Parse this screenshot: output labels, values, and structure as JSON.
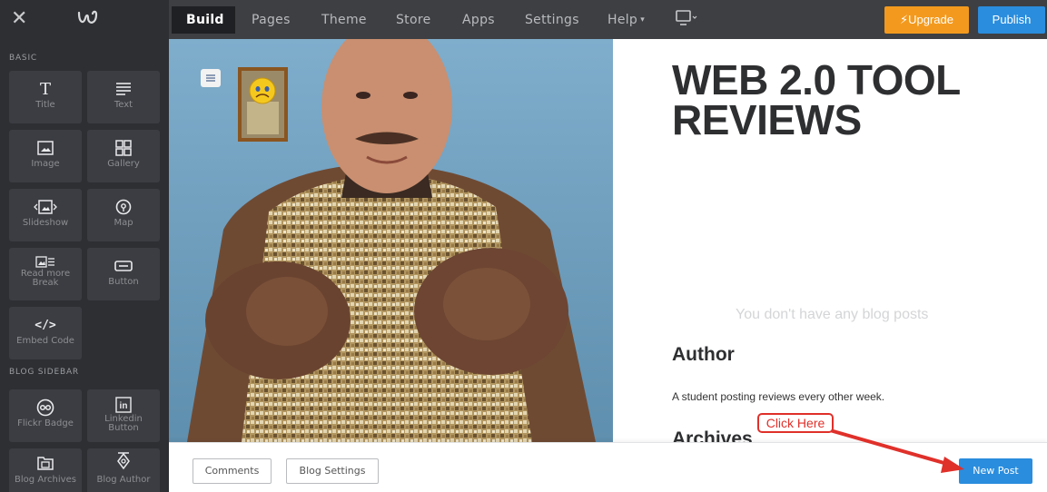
{
  "topbar": {
    "close_glyph": "✕",
    "logo_icon": "weebly-logo-icon",
    "nav": [
      {
        "label": "Build",
        "active": true
      },
      {
        "label": "Pages"
      },
      {
        "label": "Theme"
      },
      {
        "label": "Store"
      },
      {
        "label": "Apps"
      },
      {
        "label": "Settings"
      },
      {
        "label": "Help",
        "caret": true
      }
    ],
    "device_icon": "desktop-icon",
    "upgrade_label": "Upgrade",
    "publish_label": "Publish",
    "colors": {
      "upgrade": "#f39a1e",
      "publish": "#2a8ddd",
      "bar": "#3d3f43"
    }
  },
  "sidebar": {
    "sections": [
      {
        "label": "BASIC",
        "items": [
          {
            "label": "Title",
            "icon": "title-icon"
          },
          {
            "label": "Text",
            "icon": "text-icon"
          },
          {
            "label": "Image",
            "icon": "image-icon"
          },
          {
            "label": "Gallery",
            "icon": "gallery-icon"
          },
          {
            "label": "Slideshow",
            "icon": "slideshow-icon"
          },
          {
            "label": "Map",
            "icon": "map-icon"
          },
          {
            "label": "Read more Break",
            "icon": "read-more-icon"
          },
          {
            "label": "Button",
            "icon": "button-icon"
          },
          {
            "label": "Embed Code",
            "icon": "embed-code-icon"
          }
        ]
      },
      {
        "label": "BLOG SIDEBAR",
        "items": [
          {
            "label": "Flickr Badge",
            "icon": "flickr-icon"
          },
          {
            "label": "Linkedin Button",
            "icon": "linkedin-icon"
          },
          {
            "label": "Blog Archives",
            "icon": "blog-archives-icon"
          },
          {
            "label": "Blog Author",
            "icon": "blog-author-icon"
          }
        ]
      }
    ]
  },
  "canvas": {
    "photo": "muscular-man-photo",
    "blog_title": "WEB 2.0 TOOL REVIEWS",
    "empty_note": "You don't have any blog posts",
    "author_heading": "Author",
    "author_text": "A student posting reviews every other week.",
    "archives_heading": "Archives"
  },
  "bottombar": {
    "comments_label": "Comments",
    "blog_settings_label": "Blog Settings",
    "new_post_label": "New Post"
  },
  "annotation": {
    "callout_text": "Click Here",
    "color": "#e0302a"
  }
}
